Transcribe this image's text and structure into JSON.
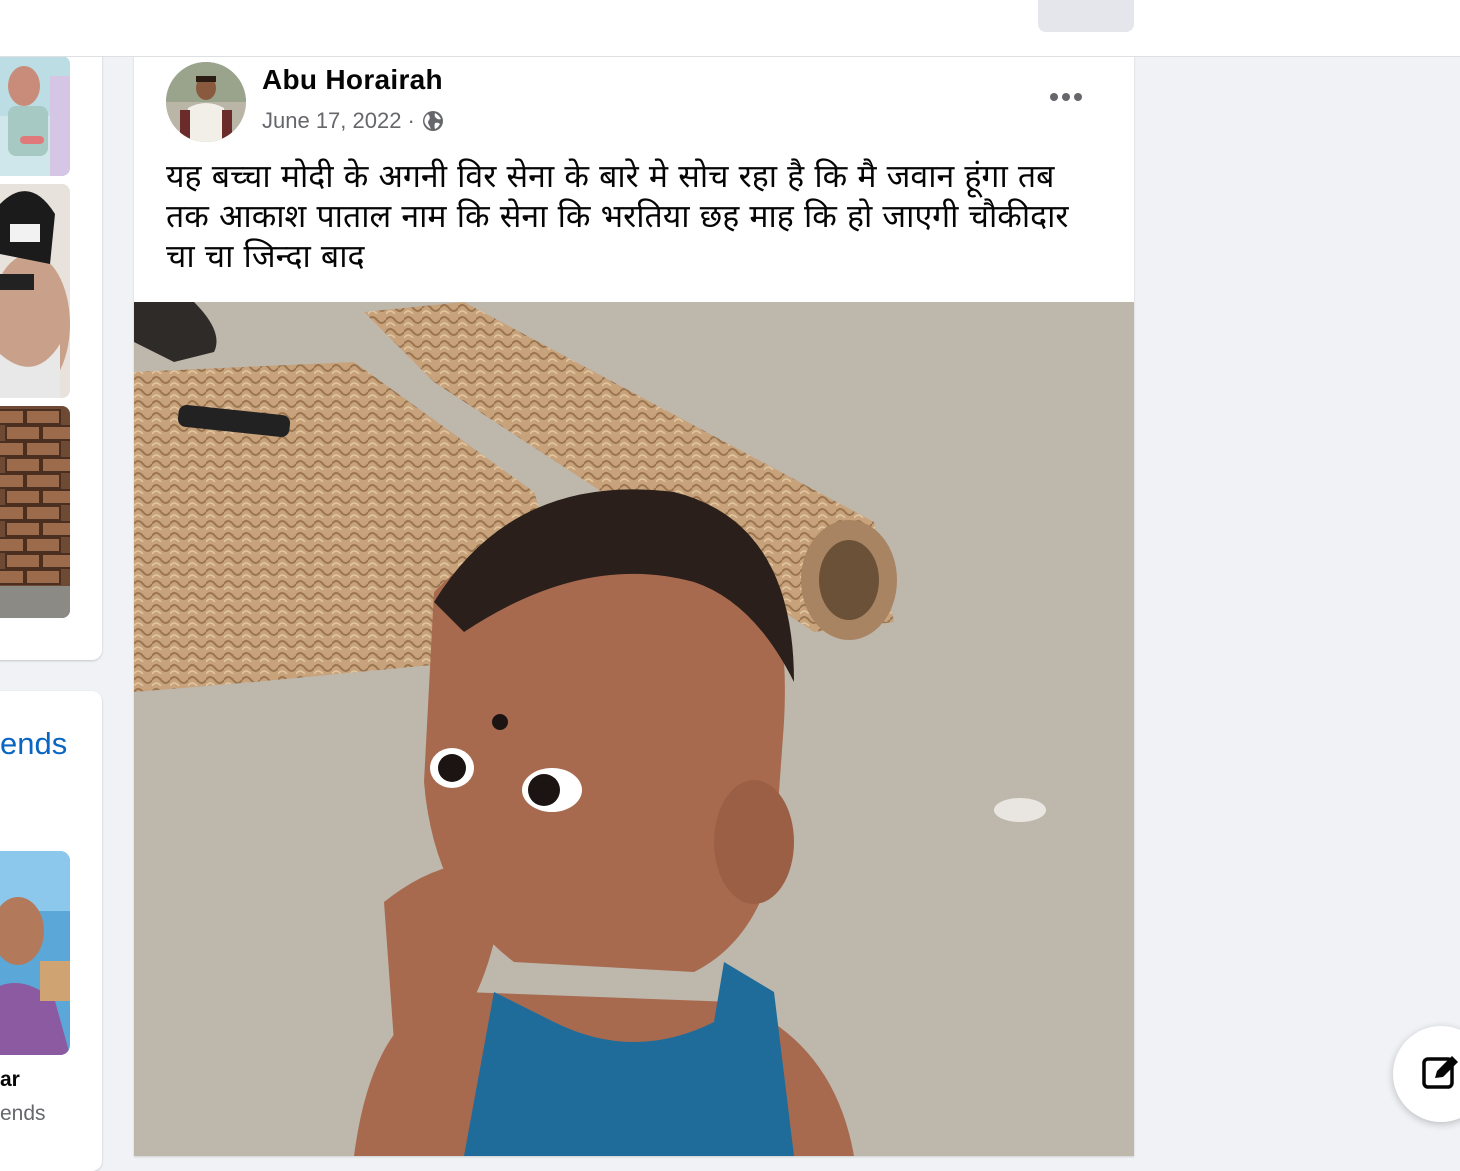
{
  "left_column": {
    "friends_link_text": "ends",
    "friend_name": "ar",
    "friend_subtext": "ends"
  },
  "post": {
    "author": "Abu Horairah",
    "date": "June 17, 2022",
    "separator": "·",
    "privacy_icon": "globe-icon",
    "more_icon": "more-options-icon",
    "text": "यह बच्चा मोदी के अगनी विर सेना के बारे मे सोच रहा है कि मै जवान हूंगा तब तक आकाश पाताल नाम कि सेना कि भरतिया छह माह कि हो जाएगी  चौकीदार चा चा जिन्दा बाद"
  },
  "floating": {
    "compose_icon": "compose-message-icon"
  },
  "colors": {
    "link": "#0a66c2",
    "background": "#f0f2f5",
    "text_secondary": "#65676b"
  }
}
